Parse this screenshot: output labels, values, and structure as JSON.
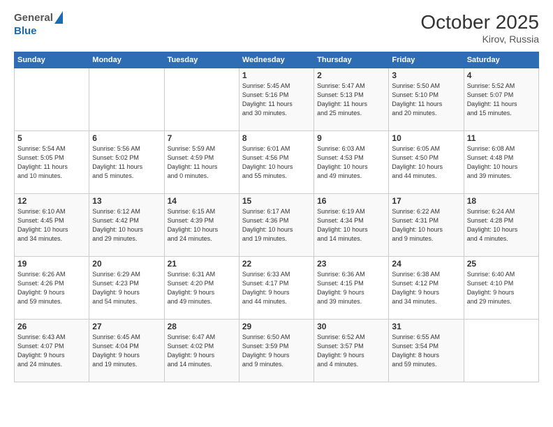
{
  "header": {
    "logo_general": "General",
    "logo_blue": "Blue",
    "month": "October 2025",
    "location": "Kirov, Russia"
  },
  "weekdays": [
    "Sunday",
    "Monday",
    "Tuesday",
    "Wednesday",
    "Thursday",
    "Friday",
    "Saturday"
  ],
  "weeks": [
    [
      {
        "day": "",
        "info": ""
      },
      {
        "day": "",
        "info": ""
      },
      {
        "day": "",
        "info": ""
      },
      {
        "day": "1",
        "info": "Sunrise: 5:45 AM\nSunset: 5:16 PM\nDaylight: 11 hours\nand 30 minutes."
      },
      {
        "day": "2",
        "info": "Sunrise: 5:47 AM\nSunset: 5:13 PM\nDaylight: 11 hours\nand 25 minutes."
      },
      {
        "day": "3",
        "info": "Sunrise: 5:50 AM\nSunset: 5:10 PM\nDaylight: 11 hours\nand 20 minutes."
      },
      {
        "day": "4",
        "info": "Sunrise: 5:52 AM\nSunset: 5:07 PM\nDaylight: 11 hours\nand 15 minutes."
      }
    ],
    [
      {
        "day": "5",
        "info": "Sunrise: 5:54 AM\nSunset: 5:05 PM\nDaylight: 11 hours\nand 10 minutes."
      },
      {
        "day": "6",
        "info": "Sunrise: 5:56 AM\nSunset: 5:02 PM\nDaylight: 11 hours\nand 5 minutes."
      },
      {
        "day": "7",
        "info": "Sunrise: 5:59 AM\nSunset: 4:59 PM\nDaylight: 11 hours\nand 0 minutes."
      },
      {
        "day": "8",
        "info": "Sunrise: 6:01 AM\nSunset: 4:56 PM\nDaylight: 10 hours\nand 55 minutes."
      },
      {
        "day": "9",
        "info": "Sunrise: 6:03 AM\nSunset: 4:53 PM\nDaylight: 10 hours\nand 49 minutes."
      },
      {
        "day": "10",
        "info": "Sunrise: 6:05 AM\nSunset: 4:50 PM\nDaylight: 10 hours\nand 44 minutes."
      },
      {
        "day": "11",
        "info": "Sunrise: 6:08 AM\nSunset: 4:48 PM\nDaylight: 10 hours\nand 39 minutes."
      }
    ],
    [
      {
        "day": "12",
        "info": "Sunrise: 6:10 AM\nSunset: 4:45 PM\nDaylight: 10 hours\nand 34 minutes."
      },
      {
        "day": "13",
        "info": "Sunrise: 6:12 AM\nSunset: 4:42 PM\nDaylight: 10 hours\nand 29 minutes."
      },
      {
        "day": "14",
        "info": "Sunrise: 6:15 AM\nSunset: 4:39 PM\nDaylight: 10 hours\nand 24 minutes."
      },
      {
        "day": "15",
        "info": "Sunrise: 6:17 AM\nSunset: 4:36 PM\nDaylight: 10 hours\nand 19 minutes."
      },
      {
        "day": "16",
        "info": "Sunrise: 6:19 AM\nSunset: 4:34 PM\nDaylight: 10 hours\nand 14 minutes."
      },
      {
        "day": "17",
        "info": "Sunrise: 6:22 AM\nSunset: 4:31 PM\nDaylight: 10 hours\nand 9 minutes."
      },
      {
        "day": "18",
        "info": "Sunrise: 6:24 AM\nSunset: 4:28 PM\nDaylight: 10 hours\nand 4 minutes."
      }
    ],
    [
      {
        "day": "19",
        "info": "Sunrise: 6:26 AM\nSunset: 4:26 PM\nDaylight: 9 hours\nand 59 minutes."
      },
      {
        "day": "20",
        "info": "Sunrise: 6:29 AM\nSunset: 4:23 PM\nDaylight: 9 hours\nand 54 minutes."
      },
      {
        "day": "21",
        "info": "Sunrise: 6:31 AM\nSunset: 4:20 PM\nDaylight: 9 hours\nand 49 minutes."
      },
      {
        "day": "22",
        "info": "Sunrise: 6:33 AM\nSunset: 4:17 PM\nDaylight: 9 hours\nand 44 minutes."
      },
      {
        "day": "23",
        "info": "Sunrise: 6:36 AM\nSunset: 4:15 PM\nDaylight: 9 hours\nand 39 minutes."
      },
      {
        "day": "24",
        "info": "Sunrise: 6:38 AM\nSunset: 4:12 PM\nDaylight: 9 hours\nand 34 minutes."
      },
      {
        "day": "25",
        "info": "Sunrise: 6:40 AM\nSunset: 4:10 PM\nDaylight: 9 hours\nand 29 minutes."
      }
    ],
    [
      {
        "day": "26",
        "info": "Sunrise: 6:43 AM\nSunset: 4:07 PM\nDaylight: 9 hours\nand 24 minutes."
      },
      {
        "day": "27",
        "info": "Sunrise: 6:45 AM\nSunset: 4:04 PM\nDaylight: 9 hours\nand 19 minutes."
      },
      {
        "day": "28",
        "info": "Sunrise: 6:47 AM\nSunset: 4:02 PM\nDaylight: 9 hours\nand 14 minutes."
      },
      {
        "day": "29",
        "info": "Sunrise: 6:50 AM\nSunset: 3:59 PM\nDaylight: 9 hours\nand 9 minutes."
      },
      {
        "day": "30",
        "info": "Sunrise: 6:52 AM\nSunset: 3:57 PM\nDaylight: 9 hours\nand 4 minutes."
      },
      {
        "day": "31",
        "info": "Sunrise: 6:55 AM\nSunset: 3:54 PM\nDaylight: 8 hours\nand 59 minutes."
      },
      {
        "day": "",
        "info": ""
      }
    ]
  ]
}
